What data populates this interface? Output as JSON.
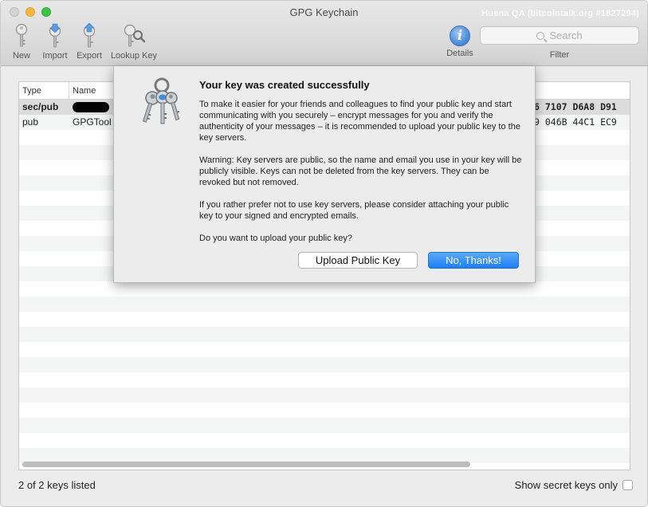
{
  "window": {
    "title": "GPG Keychain",
    "watermark": "Husna QA (bitcointalk.org #1827294)"
  },
  "toolbar": {
    "new_label": "New",
    "import_label": "Import",
    "export_label": "Export",
    "lookup_label": "Lookup Key",
    "details_label": "Details",
    "filter_label": "Filter",
    "search_placeholder": "Search",
    "icons": {
      "new": "key-new-icon",
      "import": "key-import-icon",
      "export": "key-export-icon",
      "lookup": "key-lookup-icon",
      "details": "info-icon",
      "search": "magnifier-icon"
    }
  },
  "table": {
    "columns": [
      "Type",
      "Name"
    ],
    "rows": [
      {
        "type": "sec/pub",
        "name": "",
        "fingerprint": "6 7107 D6A8 D91",
        "selected": true
      },
      {
        "type": "pub",
        "name": "GPGTool",
        "fingerprint": "9 046B 44C1 EC9",
        "selected": false
      }
    ]
  },
  "status": {
    "keys_listed": "2 of 2 keys listed",
    "show_secret_label": "Show secret keys only"
  },
  "dialog": {
    "title": "Your key was created successfully",
    "paragraphs": [
      "To make it easier for your friends and colleagues to find your public key and start communicating with you securely – encrypt messages for you and verify the authenticity of your messages – it is recommended to upload your public key to the key servers.",
      "Warning: Key servers are public, so the name and email you use in your key will be publicly visible. Keys can not be deleted from the key servers. They can be revoked but not removed.",
      "If you rather prefer not to use key servers, please consider attaching your public key to your signed and encrypted emails.",
      "Do you want to upload your public key?"
    ],
    "upload_button": "Upload Public Key",
    "decline_button": "No, Thanks!",
    "icon": "keychain-keys-icon"
  },
  "colors": {
    "accent": "#1c7ff4",
    "traffic_close": "#d3d3d3",
    "traffic_minimize": "#f6b73c",
    "traffic_maximize": "#3ec244"
  }
}
